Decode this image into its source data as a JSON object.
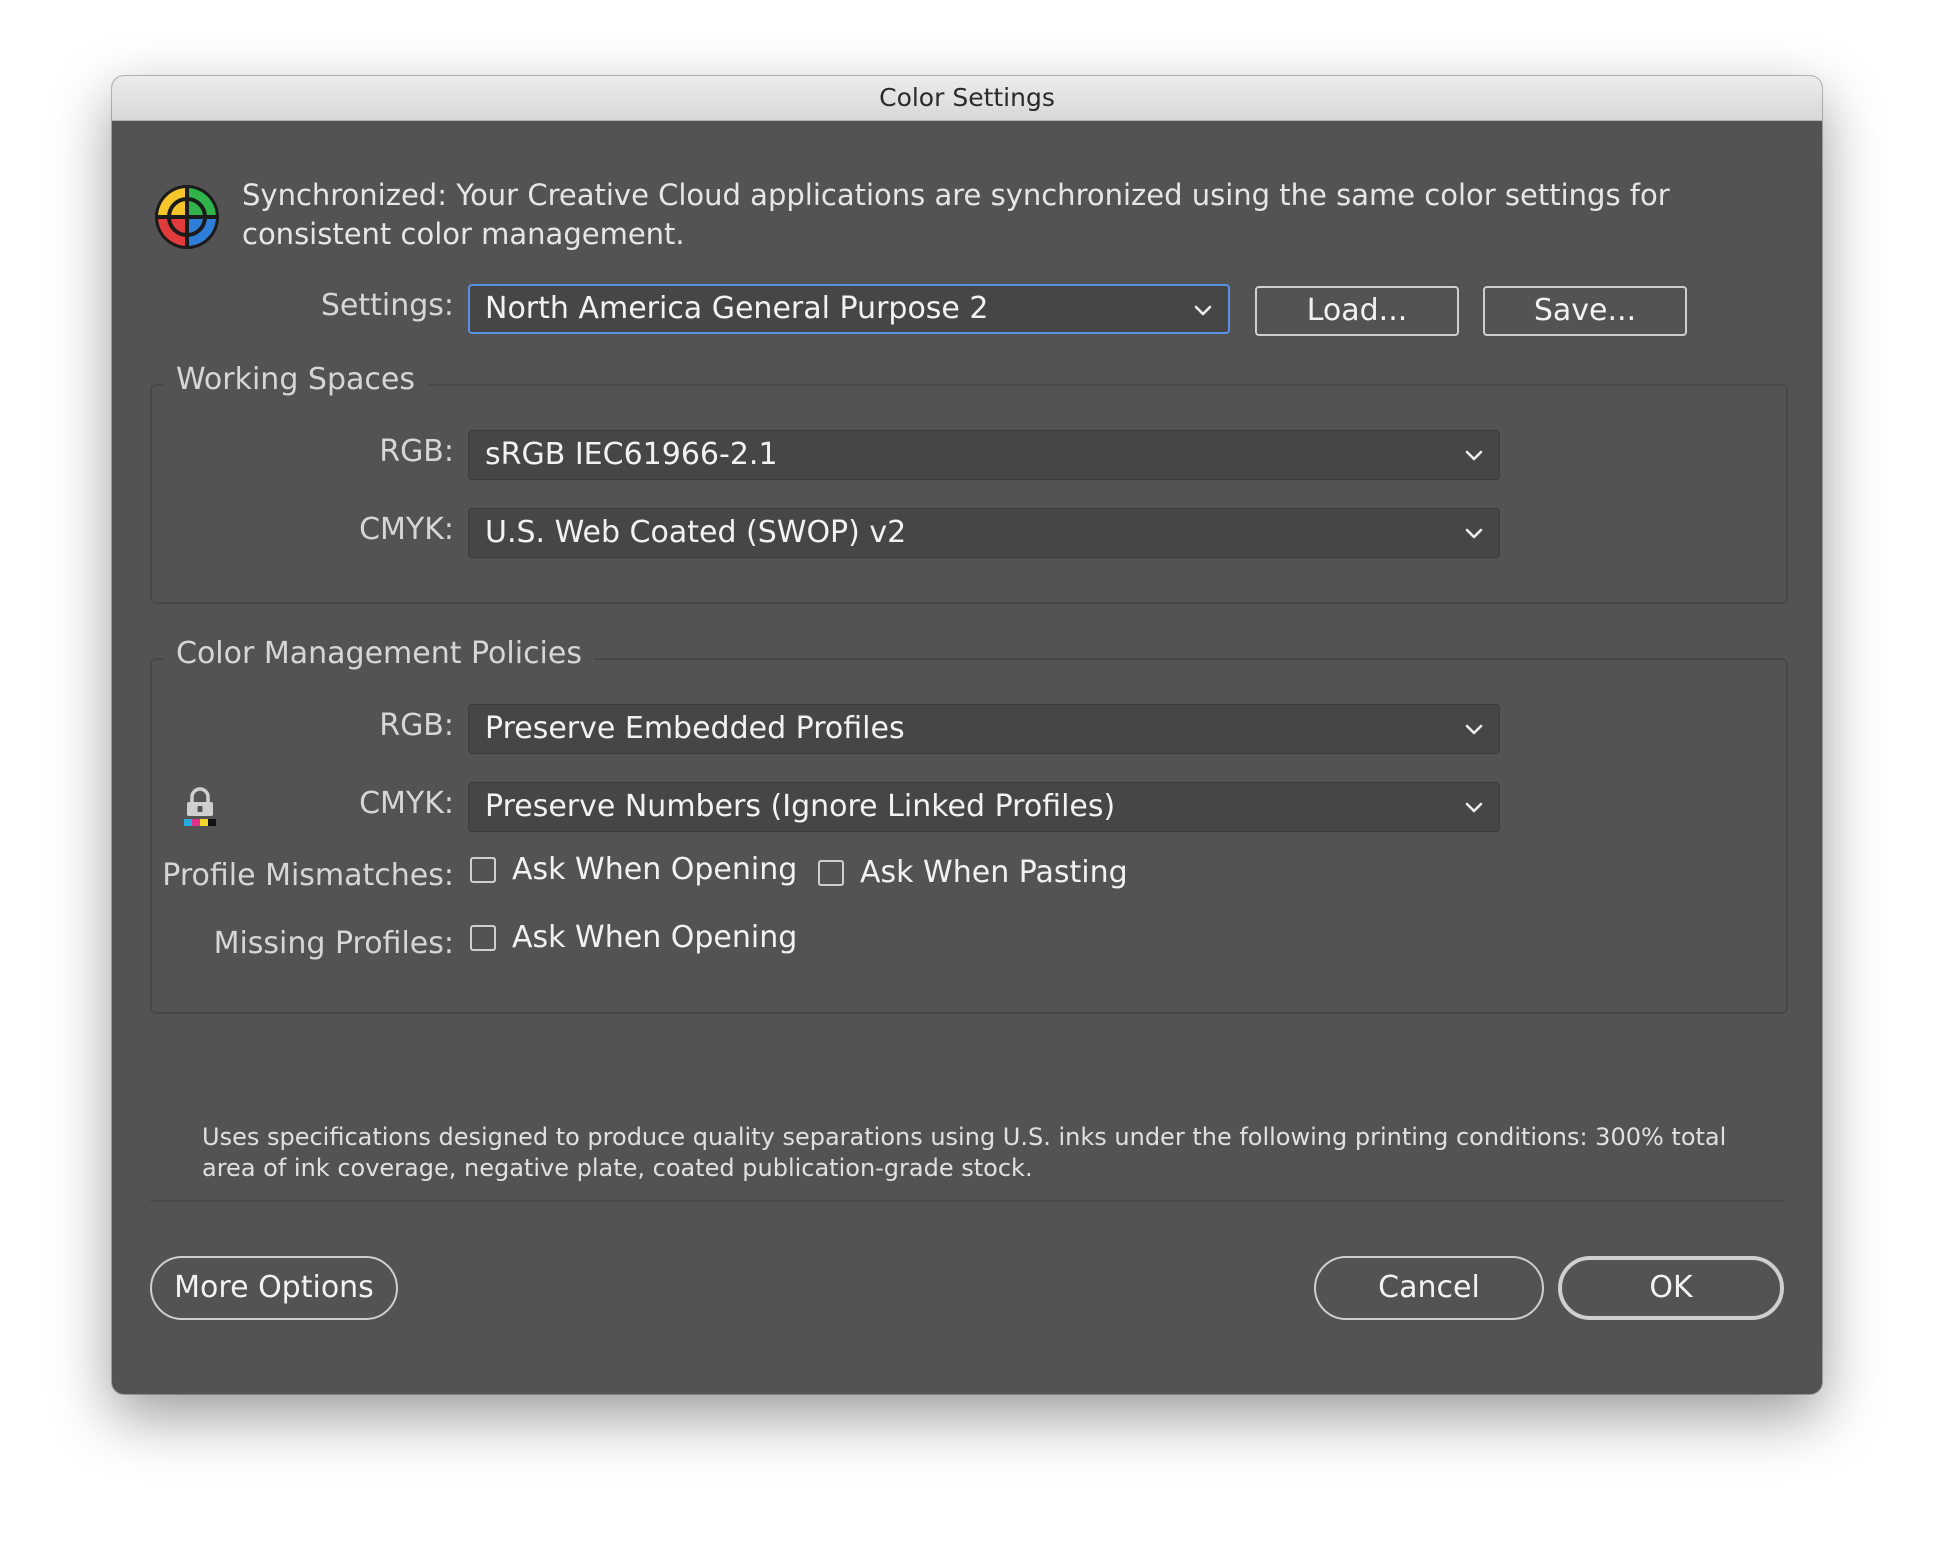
{
  "window": {
    "title": "Color Settings"
  },
  "sync": {
    "icon": "color-wheel-icon",
    "message": "Synchronized: Your Creative Cloud applications are synchronized using the same color settings for consistent color management."
  },
  "settings": {
    "label": "Settings:",
    "value": "North America General Purpose 2",
    "load_label": "Load...",
    "save_label": "Save..."
  },
  "working_spaces": {
    "title": "Working Spaces",
    "rgb_label": "RGB:",
    "rgb_value": "sRGB IEC61966-2.1",
    "cmyk_label": "CMYK:",
    "cmyk_value": "U.S. Web Coated (SWOP) v2"
  },
  "policies": {
    "title": "Color Management Policies",
    "rgb_label": "RGB:",
    "rgb_value": "Preserve Embedded Profiles",
    "cmyk_label": "CMYK:",
    "cmyk_value": "Preserve Numbers (Ignore Linked Profiles)",
    "mismatch_label": "Profile Mismatches:",
    "mismatch_open_label": "Ask When Opening",
    "mismatch_open_checked": false,
    "mismatch_paste_label": "Ask When Pasting",
    "mismatch_paste_checked": false,
    "missing_label": "Missing Profiles:",
    "missing_open_label": "Ask When Opening",
    "missing_open_checked": false
  },
  "description": "Uses specifications designed to produce quality separations using U.S. inks under the following printing conditions: 300% total area of ink coverage, negative plate, coated publication-grade stock.",
  "footer": {
    "more_options_label": "More Options",
    "cancel_label": "Cancel",
    "ok_label": "OK"
  },
  "colors": {
    "dialog_background": "#535353",
    "focus_ring": "#5a8fe6",
    "title_bar": "#dedede"
  }
}
